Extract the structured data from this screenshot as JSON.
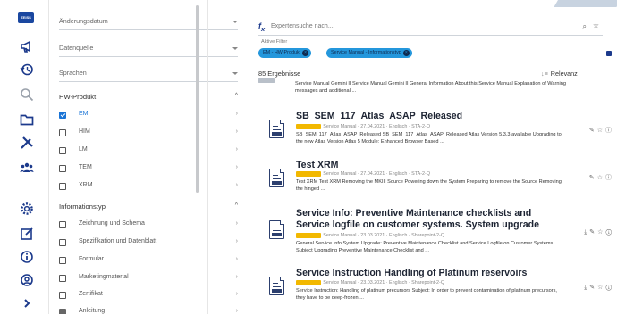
{
  "rail": {
    "logo": "ZEISS",
    "icons": [
      "megaphone-icon",
      "history-icon",
      "search-icon",
      "folder-icon",
      "tools-icon",
      "team-icon",
      "settings-icon",
      "edit-icon",
      "info-icon",
      "help-icon",
      "expand-icon"
    ]
  },
  "filters": {
    "dropdowns": [
      "Änderungsdatum",
      "Datenquelle",
      "Sprachen"
    ],
    "groups": [
      {
        "title": "HW-Produkt",
        "options": [
          {
            "label": "EM",
            "checked": true
          },
          {
            "label": "HIM",
            "checked": false
          },
          {
            "label": "LM",
            "checked": false
          },
          {
            "label": "TEM",
            "checked": false
          },
          {
            "label": "XRM",
            "checked": false
          }
        ]
      },
      {
        "title": "Informationstyp",
        "options": [
          {
            "label": "Zeichnung und Schema",
            "checked": false
          },
          {
            "label": "Spezifikation und Datenblatt",
            "checked": false
          },
          {
            "label": "Formular",
            "checked": false
          },
          {
            "label": "Marketingmaterial",
            "checked": false
          },
          {
            "label": "Zertifikat",
            "checked": false
          },
          {
            "label": "Anleitung",
            "checked": false
          }
        ]
      }
    ]
  },
  "search": {
    "placeholder": "Expertensuche nach..."
  },
  "active_filters": {
    "label": "Aktive Filter",
    "chips": [
      "EM - HW-Produkt",
      "Service Manual - Informationstyp"
    ]
  },
  "results_header": {
    "count": "85 Ergebnisse",
    "sort": "Relevanz"
  },
  "results": [
    {
      "title": "",
      "meta_tag": "",
      "meta": "",
      "description": "Service Manual Gemini II Service Manual Gemini II General Information About this Service Manual Explanation of Warning messages and additional ..."
    },
    {
      "title": "SB_SEM_117_Atlas_ASAP_Released",
      "meta_tag": "Restricted",
      "meta": "Service Manual · 27.04.2021 · Englisch · STA-2-Q",
      "description": "SB_SEM_117_Atlas_ASAP_Released SB_SEM_117_Atlas_ASAP_Released Atlas Version 5.3.3 available Upgrading to the new Atlas Version Atlas 5 Module: Enhanced Browser Based ..."
    },
    {
      "title": "Test XRM",
      "meta_tag": "Restricted",
      "meta": "Service Manual · 27.04.2021 · Englisch · STA-2-Q",
      "description": "Test XRM Test XRM Removing the MKIII Source Powering down the System Preparing to remove the Source Removing the hinged ..."
    },
    {
      "title": "Service Info: Preventive Maintenance checklists and Service logfile on customer systems. System upgrade",
      "meta_tag": "Restricted",
      "meta": "Service Manual · 23.03.2021 · Englisch · Sharepoint-2-Q",
      "description": "General Service Info System Upgrade: Preventive Maintenance Checklist and Service Logfile on Customer Systems Subject Upgrading Preventive Maintenance Checklist and ..."
    },
    {
      "title": "Service Instruction Handling of Platinum reservoirs",
      "meta_tag": "Restricted",
      "meta": "Service Manual · 23.03.2021 · Englisch · Sharepoint-2-Q",
      "description": "Service Instruction: Handling of platinum precursors Subject: In order to prevent contamination of platinum precursors, they have to be deep-frozen ..."
    }
  ]
}
